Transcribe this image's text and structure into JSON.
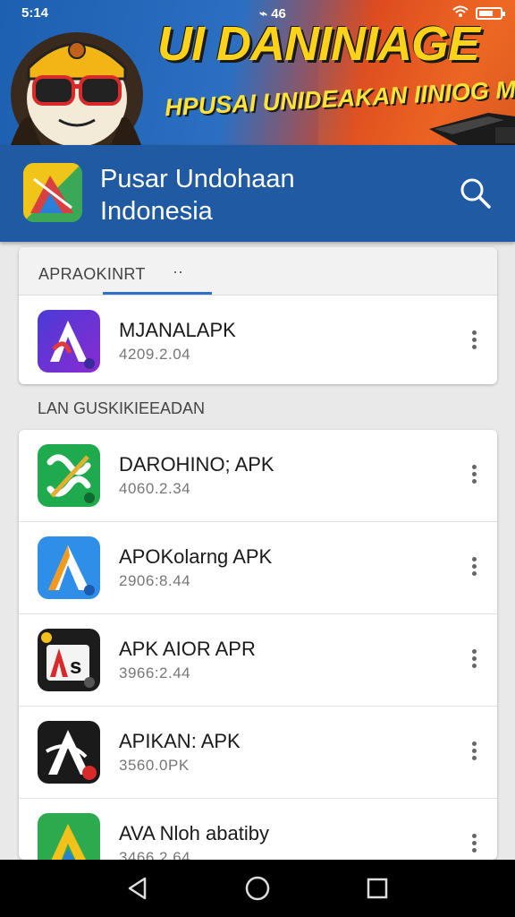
{
  "status": {
    "time": "5:14",
    "center": "⌁ 46",
    "battery_level": 0.7
  },
  "banner": {
    "title": "UI DANINIAGE",
    "subtitle": "HPUSAI UNIDEAKAN IINIOG MAN"
  },
  "appbar": {
    "title_line1": "Pusar Undohaan",
    "title_line2": "Indonesia"
  },
  "section1": {
    "header": "APRAOKINRT",
    "header_extra": "··"
  },
  "featured": {
    "name": "MJANALAPK",
    "version": "4209.2.04"
  },
  "section2": {
    "label": "LAN GUSKIKIEEADAN"
  },
  "apps": [
    {
      "name": "DAROHINO; APK",
      "version": "4060.2.34"
    },
    {
      "name": "APOKolarng APK",
      "version": "2906:8.44"
    },
    {
      "name": "APK AIOR APR",
      "version": "3966:2.44"
    },
    {
      "name": "APIKAN: APK",
      "version": "3560.0PK"
    },
    {
      "name": "AVA Nloh abatiby",
      "version": "3466.2.64"
    }
  ],
  "colors": {
    "appbar": "#1f5aa3",
    "accent": "#2f6fc6",
    "banner_text": "#ffd21a"
  },
  "icons": [
    "search-icon",
    "more-vert-icon",
    "nav-back-icon",
    "nav-home-icon",
    "nav-recents-icon"
  ]
}
